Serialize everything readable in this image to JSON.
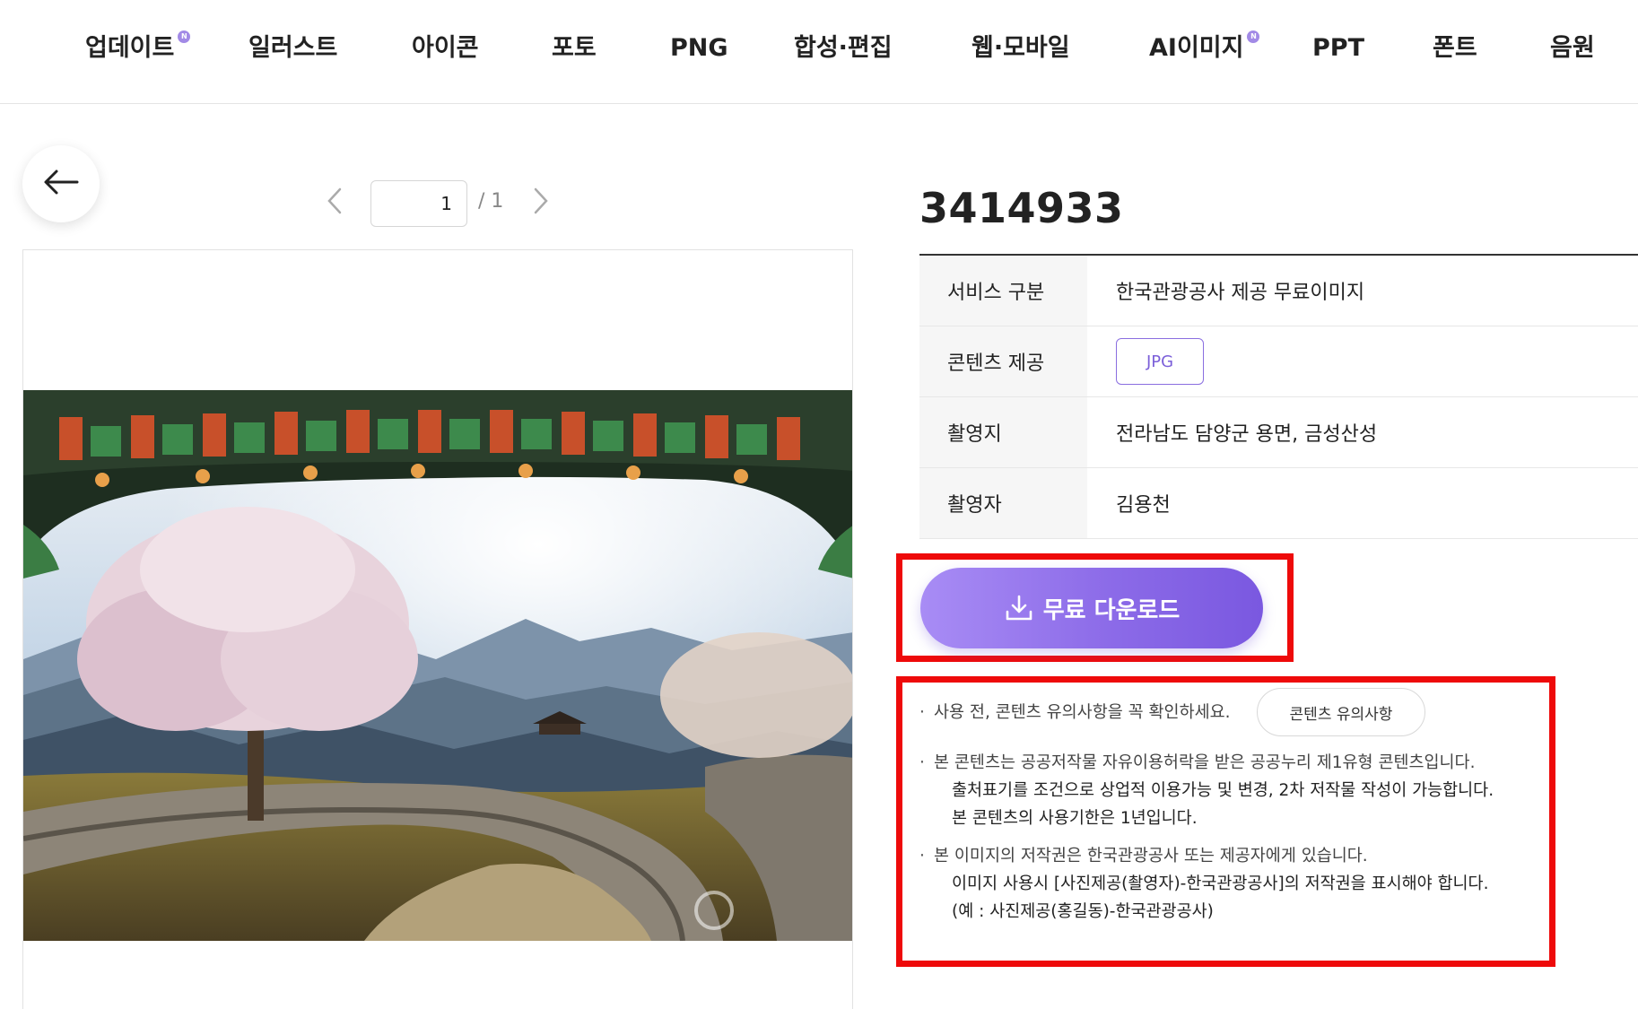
{
  "nav": {
    "items": [
      {
        "label": "업데이트",
        "badge": "N"
      },
      {
        "label": "일러스트"
      },
      {
        "label": "아이콘"
      },
      {
        "label": "포토"
      },
      {
        "label": "PNG"
      },
      {
        "label": "합성·편집"
      },
      {
        "label": "웹·모바일"
      },
      {
        "label": "AI이미지",
        "badge": "N"
      },
      {
        "label": "PPT"
      },
      {
        "label": "폰트"
      },
      {
        "label": "음원"
      }
    ]
  },
  "back_button": {
    "icon": "arrow-left-icon"
  },
  "pager": {
    "current": "1",
    "total": "/ 1",
    "prev_icon": "chevron-left-icon",
    "next_icon": "chevron-right-icon"
  },
  "content": {
    "id": "3414933",
    "rows": [
      {
        "key": "서비스 구분",
        "value": "한국관광공사 제공 무료이미지"
      },
      {
        "key": "콘텐츠 제공",
        "value": "JPG"
      },
      {
        "key": "촬영지",
        "value": "전라남도 담양군 용면, 금성산성"
      },
      {
        "key": "촬영자",
        "value": "김용천"
      }
    ]
  },
  "download": {
    "label": "무료 다운로드",
    "icon": "download-icon"
  },
  "notices": {
    "caution_text": "사용 전, 콘텐츠 유의사항을 꼭 확인하세요.",
    "caution_button": "콘텐츠 유의사항",
    "license_line1": "본 콘텐츠는 공공저작물 자유이용허락을 받은 공공누리 제1유형 콘텐츠입니다.",
    "license_line2": "출처표기를 조건으로 상업적 이용가능 및 변경, 2차 저작물 작성이 가능합니다.",
    "license_line3": "본 콘텐츠의 사용기한은 1년입니다.",
    "copyright_line1": "본 이미지의 저작권은 한국관광공사 또는 제공자에게 있습니다.",
    "copyright_line2": "이미지 사용시 [사진제공(촬영자)-한국관광공사]의 저작권을 표시해야 합니다.",
    "copyright_line3": "(예 : 사진제공(홍길동)-한국관광공사)"
  },
  "colors": {
    "accent": "#8c6be8",
    "highlight": "#ee0a0a",
    "badge": "#a28ae6"
  }
}
